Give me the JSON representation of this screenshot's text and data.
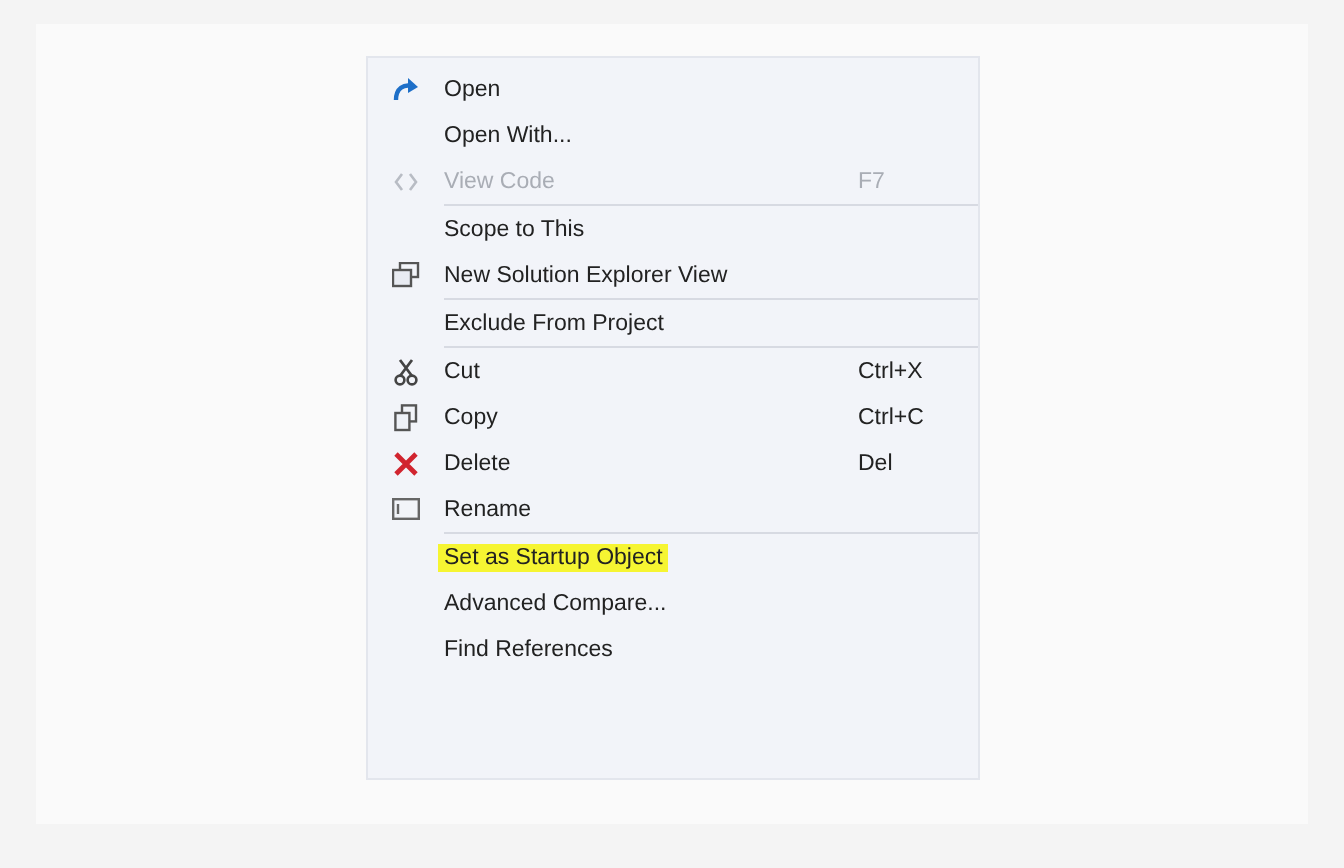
{
  "context_menu": {
    "groups": [
      [
        {
          "label": "Open",
          "disabled": false,
          "highlighted": false
        },
        {
          "label": "Open With...",
          "disabled": false,
          "highlighted": false
        },
        {
          "label": "View Code",
          "shortcut": "F7",
          "disabled": true,
          "highlighted": false
        }
      ],
      [
        {
          "label": "Scope to This",
          "disabled": false,
          "highlighted": false
        },
        {
          "label": "New Solution Explorer View",
          "disabled": false,
          "highlighted": false
        }
      ],
      [
        {
          "label": "Exclude From Project",
          "disabled": false,
          "highlighted": false
        }
      ],
      [
        {
          "label": "Cut",
          "shortcut": "Ctrl+X",
          "disabled": false,
          "highlighted": false
        },
        {
          "label": "Copy",
          "shortcut": "Ctrl+C",
          "disabled": false,
          "highlighted": false
        },
        {
          "label": "Delete",
          "shortcut": "Del",
          "disabled": false,
          "highlighted": false
        },
        {
          "label": "Rename",
          "disabled": false,
          "highlighted": false
        }
      ],
      [
        {
          "label": "Set as Startup Object",
          "disabled": false,
          "highlighted": true
        },
        {
          "label": "Advanced Compare...",
          "disabled": false,
          "highlighted": false
        },
        {
          "label": "Find References",
          "disabled": false,
          "highlighted": false
        }
      ]
    ]
  }
}
